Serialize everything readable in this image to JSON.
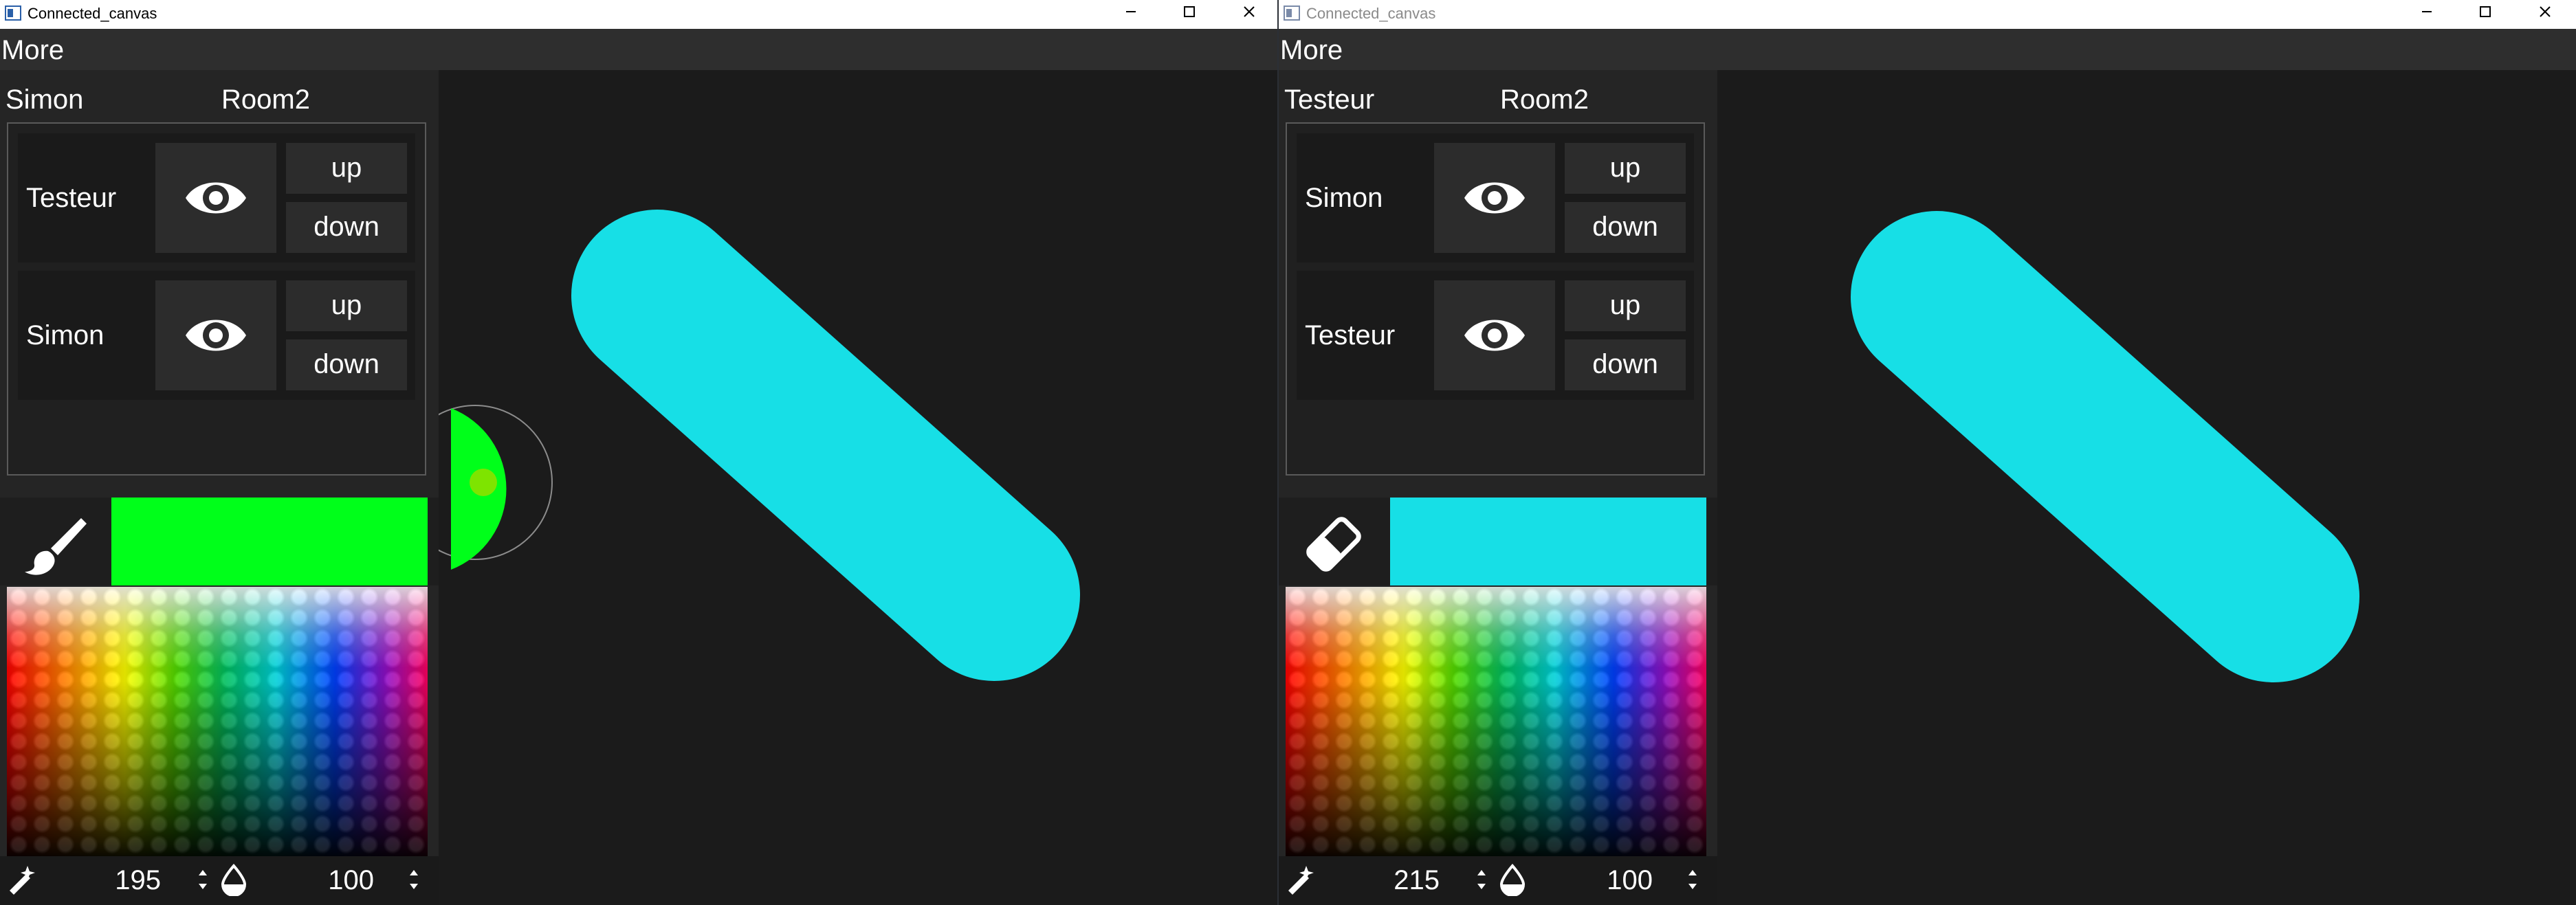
{
  "left_window": {
    "title": "Connected_canvas",
    "menu": "More",
    "user": "Simon",
    "room": "Room2",
    "layers": [
      {
        "name": "Testeur",
        "up": "up",
        "down": "down"
      },
      {
        "name": "Simon",
        "up": "up",
        "down": "down"
      }
    ],
    "tool": "brush-icon",
    "current_color": "#00ff1a",
    "size_value": "195",
    "opacity_value": "100",
    "stroke_color": "#17dfe6"
  },
  "right_window": {
    "title": "Connected_canvas",
    "menu": "More",
    "user": "Testeur",
    "room": "Room2",
    "layers": [
      {
        "name": "Simon",
        "up": "up",
        "down": "down"
      },
      {
        "name": "Testeur",
        "up": "up",
        "down": "down"
      }
    ],
    "tool": "eraser-icon",
    "current_color": "#17dfe6",
    "size_value": "215",
    "opacity_value": "100",
    "stroke_color": "#17dfe6"
  }
}
